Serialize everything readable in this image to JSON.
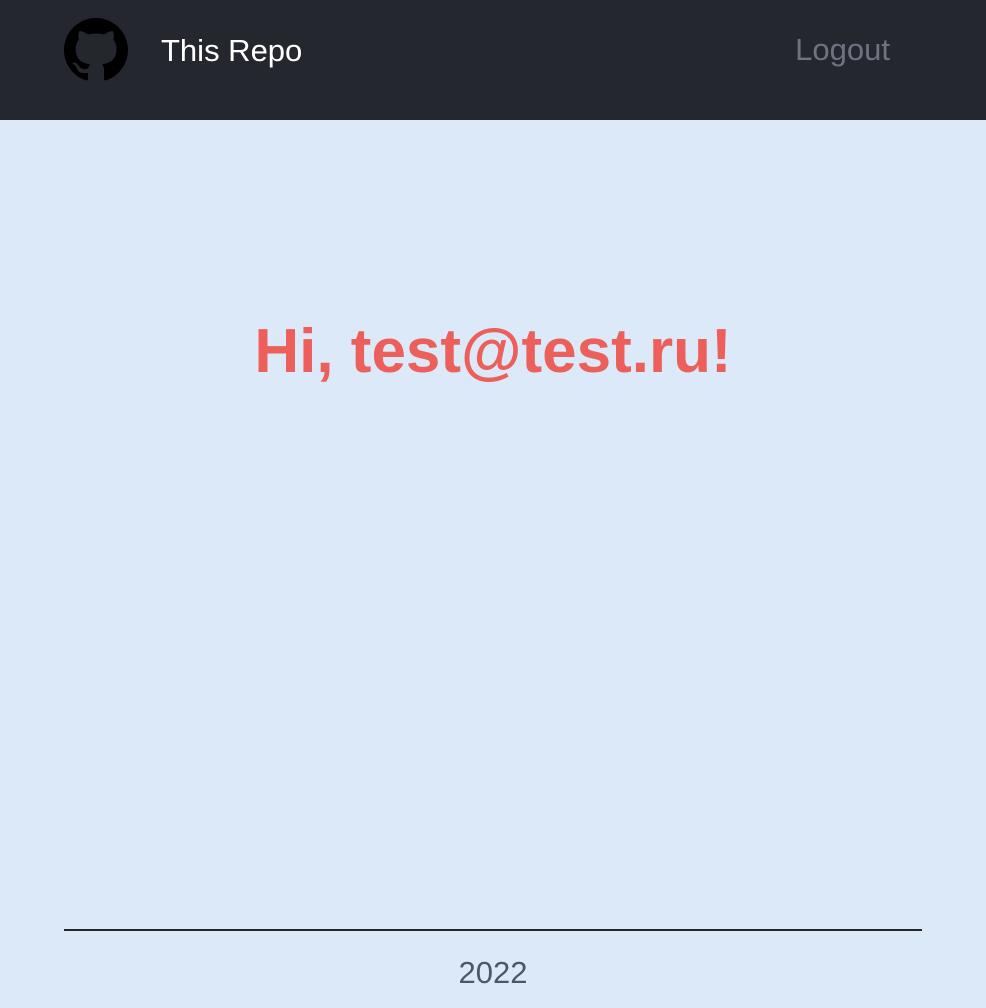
{
  "header": {
    "logo_icon": "github-octocat-icon",
    "repo_link_label": "This Repo",
    "logout_label": "Logout",
    "background_color": "#24272d"
  },
  "main": {
    "greeting": "Hi, test@test.ru!",
    "greeting_color": "#ec5f5a",
    "background_color": "#dbe9f8"
  },
  "footer": {
    "year": "2022"
  }
}
